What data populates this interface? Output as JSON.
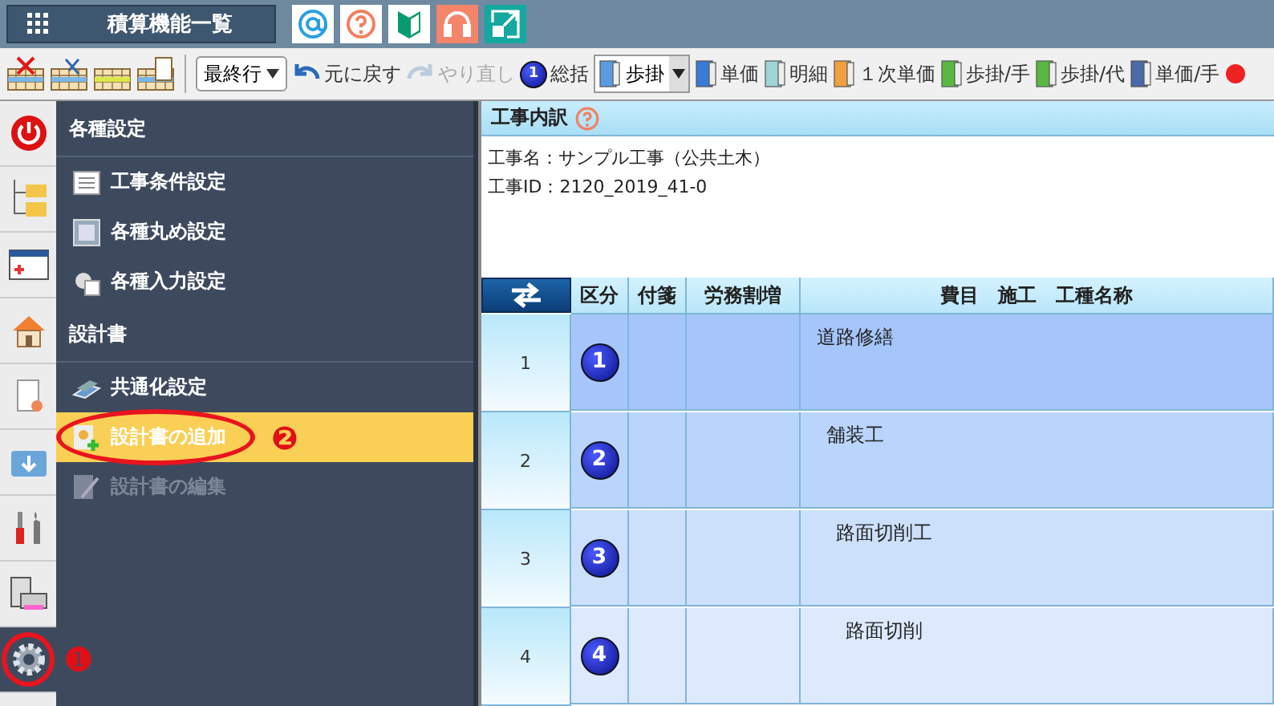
{
  "topbar": {
    "menu_button": "積算機能一覧"
  },
  "toolbar": {
    "dropdown": "最終行",
    "undo": {
      "label": "元に戻す",
      "disabled": false
    },
    "redo": {
      "label": "やり直し",
      "disabled": true
    },
    "items": [
      {
        "kind": "badge",
        "badge": "1",
        "label": "総括"
      },
      {
        "kind": "select",
        "label": "歩掛"
      },
      {
        "kind": "icon",
        "label": "単価"
      },
      {
        "kind": "icon",
        "label": "明細"
      },
      {
        "kind": "icon",
        "label": "１次単価"
      },
      {
        "kind": "icon",
        "label": "歩掛/手"
      },
      {
        "kind": "icon",
        "label": "歩掛/代"
      },
      {
        "kind": "icon",
        "label": "単価/手"
      }
    ]
  },
  "rail": [
    {
      "selected": false,
      "circled": false
    },
    {
      "selected": false,
      "circled": false
    },
    {
      "selected": false,
      "circled": false
    },
    {
      "selected": false,
      "circled": false
    },
    {
      "selected": false,
      "circled": false
    },
    {
      "selected": false,
      "circled": false
    },
    {
      "selected": false,
      "circled": false
    },
    {
      "selected": false,
      "circled": false
    },
    {
      "selected": true,
      "circled": true,
      "marker": "❶"
    }
  ],
  "menu": [
    {
      "kind": "header",
      "label": "各種設定"
    },
    {
      "kind": "item",
      "label": "工事条件設定",
      "selected": false,
      "disabled": false,
      "circled": false
    },
    {
      "kind": "item",
      "label": "各種丸め設定",
      "selected": false,
      "disabled": false,
      "circled": false
    },
    {
      "kind": "item",
      "label": "各種入力設定",
      "selected": false,
      "disabled": false,
      "circled": false
    },
    {
      "kind": "header",
      "label": "設計書"
    },
    {
      "kind": "item",
      "label": "共通化設定",
      "selected": false,
      "disabled": false,
      "circled": false
    },
    {
      "kind": "item",
      "label": "設計書の追加",
      "selected": true,
      "disabled": false,
      "circled": true,
      "marker": "❷"
    },
    {
      "kind": "item",
      "label": "設計書の編集",
      "selected": false,
      "disabled": true,
      "circled": false
    }
  ],
  "panel": {
    "title": "工事内訳",
    "info": [
      "工事名：サンプル工事（公共土木）",
      "工事ID：2120_2019_41-0"
    ],
    "columns": [
      "区分",
      "付箋",
      "労務割増",
      "費目　施工　工種名称"
    ],
    "rows": [
      {
        "number": "1",
        "badge": "1",
        "name": "道路修繕",
        "selected": true,
        "children": [
          {
            "number": "2",
            "badge": "2",
            "name": "舗装工",
            "selected": false,
            "children": [
              {
                "number": "3",
                "badge": "3",
                "name": "路面切削工",
                "selected": false,
                "children": [
                  {
                    "number": "4",
                    "badge": "4",
                    "name": "路面切削",
                    "selected": false
                  }
                ]
              }
            ]
          }
        ]
      }
    ]
  }
}
